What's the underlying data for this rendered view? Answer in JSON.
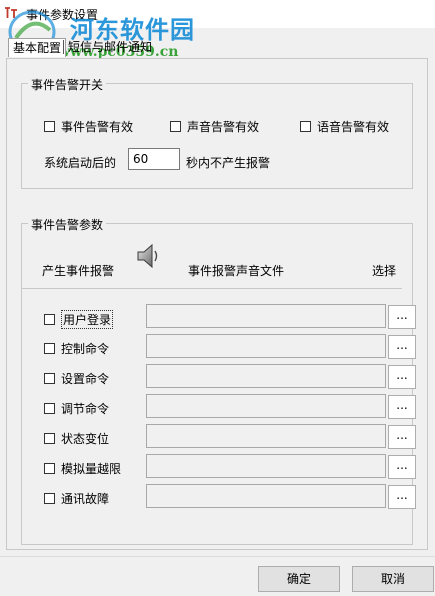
{
  "window": {
    "title": "事件参数设置"
  },
  "watermark": {
    "title": "河东软件园",
    "url": "www.pc0359.cn"
  },
  "tabs": [
    {
      "label": "基本配置"
    },
    {
      "label": "短信与邮件通知"
    }
  ],
  "switch_group": {
    "title": "事件告警开关",
    "checkboxes": [
      {
        "label": "事件告警有效",
        "checked": false
      },
      {
        "label": "声音告警有效",
        "checked": false
      },
      {
        "label": "语音告警有效",
        "checked": false
      }
    ],
    "startup_prefix": "系统启动后的",
    "startup_value": "60",
    "startup_suffix": "秒内不产生报警"
  },
  "params_group": {
    "title": "事件告警参数",
    "col_event": "产生事件报警",
    "col_file": "事件报警声音文件",
    "col_select": "选择",
    "speaker_icon": "speaker-icon",
    "browse_label": "...",
    "rows": [
      {
        "label": "用户登录",
        "checked": false,
        "file": ""
      },
      {
        "label": "控制命令",
        "checked": false,
        "file": ""
      },
      {
        "label": "设置命令",
        "checked": false,
        "file": ""
      },
      {
        "label": "调节命令",
        "checked": false,
        "file": ""
      },
      {
        "label": "状态变位",
        "checked": false,
        "file": ""
      },
      {
        "label": "模拟量越限",
        "checked": false,
        "file": ""
      },
      {
        "label": "通讯故障",
        "checked": false,
        "file": ""
      }
    ]
  },
  "buttons": {
    "ok": "确定",
    "cancel": "取消"
  }
}
